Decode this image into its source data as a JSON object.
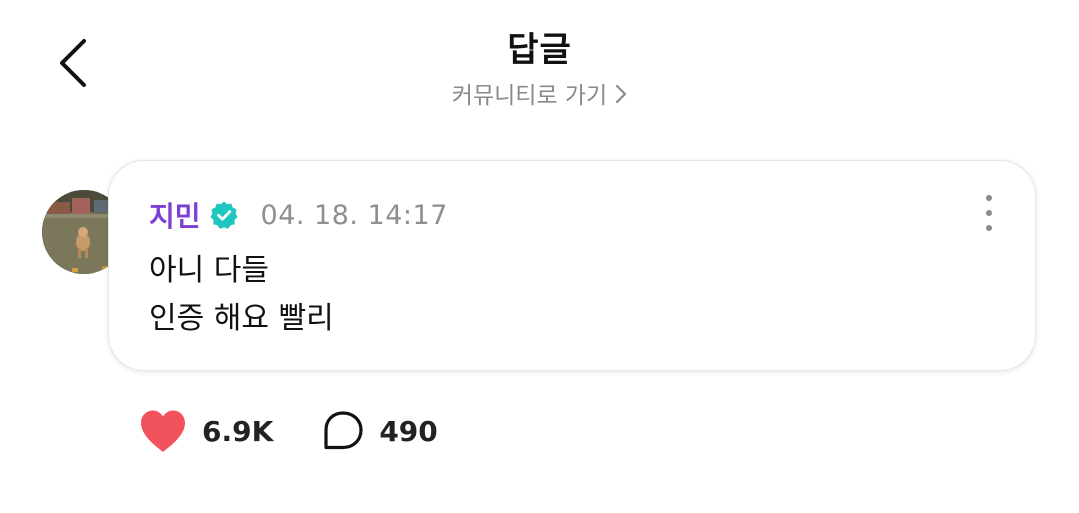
{
  "header": {
    "title": "답글",
    "community_link": "커뮤니티로 가기"
  },
  "comment": {
    "author": "지민",
    "verified": true,
    "timestamp": "04. 18. 14:17",
    "lines": [
      "아니 다들",
      "인증 해요 빨리"
    ]
  },
  "actions": {
    "likes": "6.9K",
    "replies": "490"
  },
  "colors": {
    "author": "#7b3fd4",
    "verified_badge": "#1ec6c0",
    "heart": "#f2525c",
    "muted": "#8e8e93"
  },
  "icons": {
    "back": "chevron-left-icon",
    "community": "chevron-right-icon",
    "verified": "verified-badge-icon",
    "more": "more-vertical-icon",
    "like": "heart-icon",
    "reply": "speech-bubble-icon"
  }
}
